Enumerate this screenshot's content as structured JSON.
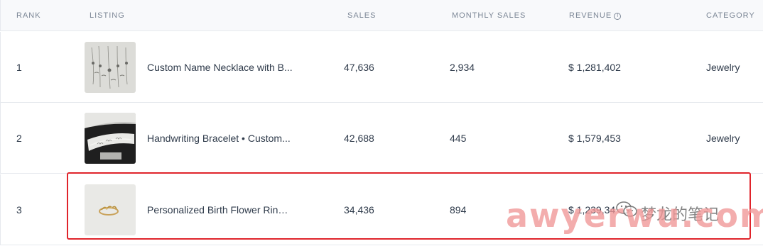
{
  "header": {
    "rank": "RANK",
    "listing": "LISTING",
    "sales": "SALES",
    "monthly_sales": "MONTHLY SALES",
    "revenue": "REVENUE",
    "category": "CATEGORY"
  },
  "rows": [
    {
      "rank": "1",
      "title": "Custom Name Necklace with B...",
      "sales": "47,636",
      "monthly_sales": "2,934",
      "revenue": "$ 1,281,402",
      "category": "Jewelry"
    },
    {
      "rank": "2",
      "title": "Handwriting Bracelet • Custom...",
      "sales": "42,688",
      "monthly_sales": "445",
      "revenue": "$ 1,579,453",
      "category": "Jewelry"
    },
    {
      "rank": "3",
      "title": "Personalized Birth Flower Ring ...",
      "sales": "34,436",
      "monthly_sales": "894",
      "revenue": "$ 1,239,34",
      "category": ""
    }
  ],
  "watermark": {
    "site": "awyerwu.com",
    "account": "梦龙的笔记"
  },
  "colors": {
    "highlight": "#e0242b"
  }
}
